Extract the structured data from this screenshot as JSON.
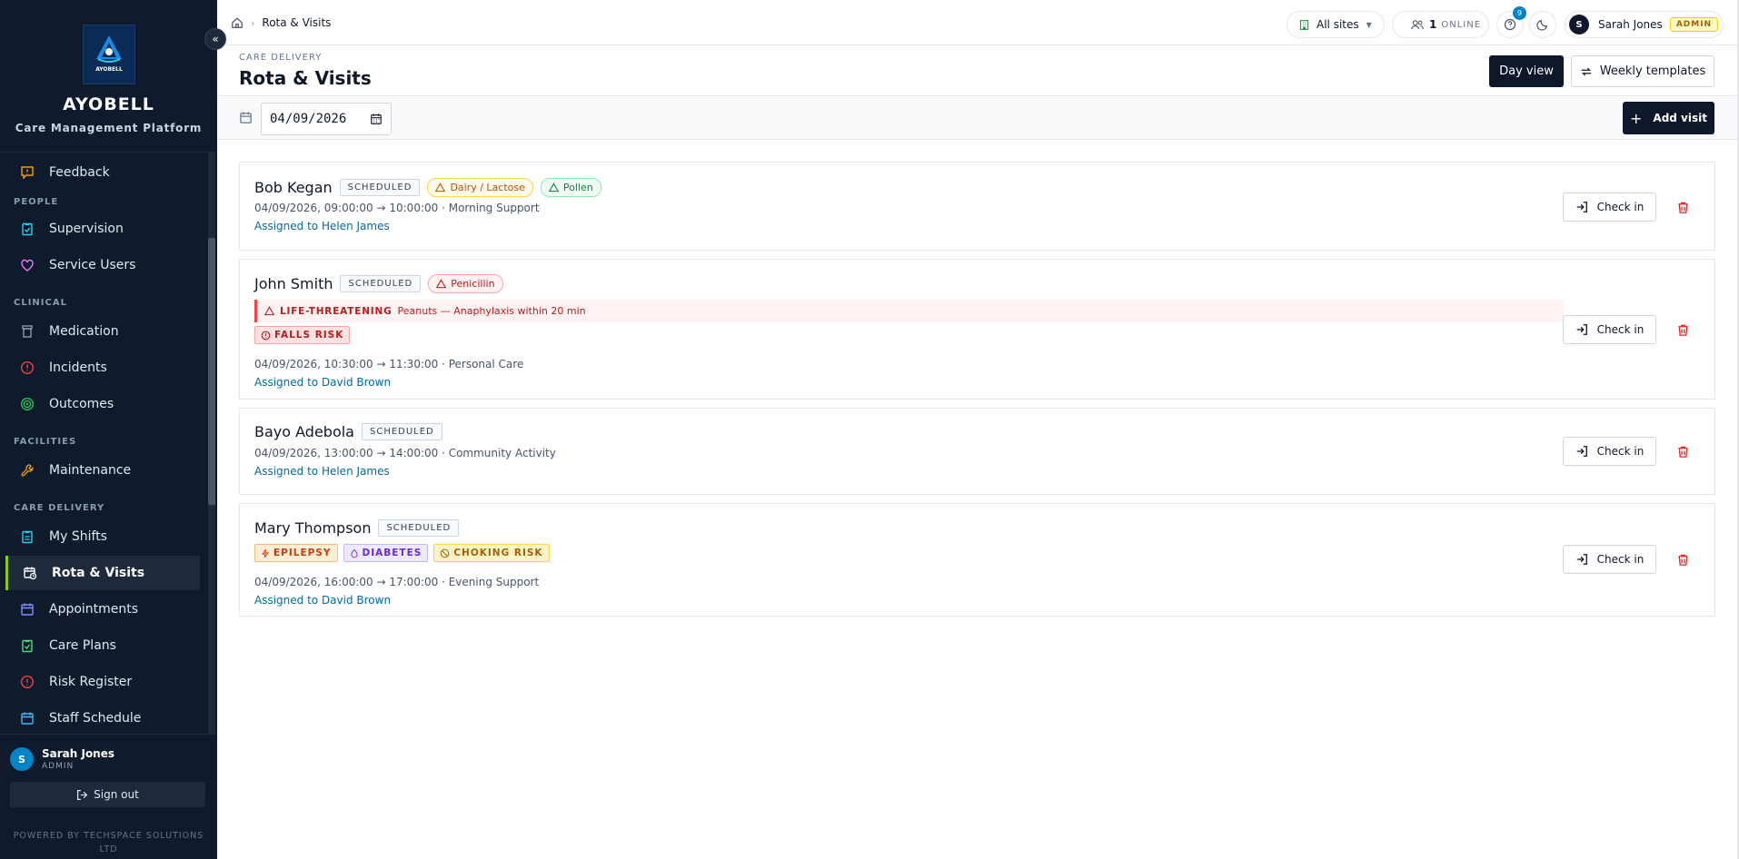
{
  "brand": {
    "name": "AYOBELL",
    "tagline": "Care Management Platform",
    "logo_text": "AYOBELL"
  },
  "nav": {
    "items": [
      {
        "label": "Feedback",
        "icon": "message-alert-icon"
      },
      {
        "label": "Supervision",
        "icon": "clipboard-check-icon"
      },
      {
        "label": "Service Users",
        "icon": "heart-handshake-icon"
      },
      {
        "label": "Medication",
        "icon": "pill-bottle-icon"
      },
      {
        "label": "Incidents",
        "icon": "alert-circle-icon"
      },
      {
        "label": "Outcomes",
        "icon": "target-icon"
      },
      {
        "label": "Maintenance",
        "icon": "wrench-icon"
      },
      {
        "label": "My Shifts",
        "icon": "clipboard-list-icon"
      },
      {
        "label": "Rota & Visits",
        "icon": "calendar-clock-icon"
      },
      {
        "label": "Appointments",
        "icon": "calendar-icon"
      },
      {
        "label": "Care Plans",
        "icon": "clipboard-check-icon"
      },
      {
        "label": "Risk Register",
        "icon": "alert-circle-icon"
      },
      {
        "label": "Staff Schedule",
        "icon": "calendar-icon"
      }
    ],
    "sections": {
      "people": "PEOPLE",
      "clinical": "CLINICAL",
      "facilities": "FACILITIES",
      "care_delivery": "CARE DELIVERY"
    },
    "active": "Rota & Visits"
  },
  "sidebar_user": {
    "initial": "S",
    "name": "Sarah Jones",
    "role": "ADMIN",
    "signout": "Sign out",
    "powered_by": "POWERED BY TECHSPACE SOLUTIONS LTD"
  },
  "topbar": {
    "breadcrumb": "Rota & Visits",
    "site_selector": "All sites",
    "online_count": "1",
    "online_label": "ONLINE",
    "notifications_count": "9",
    "user_initial": "S",
    "user_name": "Sarah Jones",
    "user_role": "ADMIN"
  },
  "header": {
    "eyebrow": "CARE DELIVERY",
    "title": "Rota & Visits",
    "day_view": "Day view",
    "weekly_templates": "Weekly templates"
  },
  "toolbar": {
    "date": "04/09/2026",
    "add_visit": "Add visit"
  },
  "visits": [
    {
      "name": "Bob Kegan",
      "status": "SCHEDULED",
      "allergies": [
        "Dairy / Lactose",
        "Pollen"
      ],
      "time": "04/09/2026, 09:00:00 → 10:00:00 · Morning Support",
      "assigned": "Assigned to Helen James",
      "check_in": "Check in"
    },
    {
      "name": "John Smith",
      "status": "SCHEDULED",
      "allergies": [
        "Penicillin"
      ],
      "alert_level": "LIFE-THREATENING",
      "alert_text": "Peanuts — Anaphylaxis within 20 min",
      "tags": [
        "FALLS RISK"
      ],
      "time": "04/09/2026, 10:30:00 → 11:30:00 · Personal Care",
      "assigned": "Assigned to David Brown",
      "check_in": "Check in"
    },
    {
      "name": "Bayo Adebola",
      "status": "SCHEDULED",
      "time": "04/09/2026, 13:00:00 → 14:00:00 · Community Activity",
      "assigned": "Assigned to Helen James",
      "check_in": "Check in"
    },
    {
      "name": "Mary Thompson",
      "status": "SCHEDULED",
      "tags": [
        "EPILEPSY",
        "DIABETES",
        "CHOKING RISK"
      ],
      "time": "04/09/2026, 16:00:00 → 17:00:00 · Evening Support",
      "assigned": "Assigned to David Brown",
      "check_in": "Check in"
    }
  ],
  "colors": {
    "sidebar_bg": "#0f1a2c",
    "active_accent": "#84cc16",
    "primary_dark": "#0f172a",
    "link": "#0369a1",
    "danger": "#dc2626"
  }
}
